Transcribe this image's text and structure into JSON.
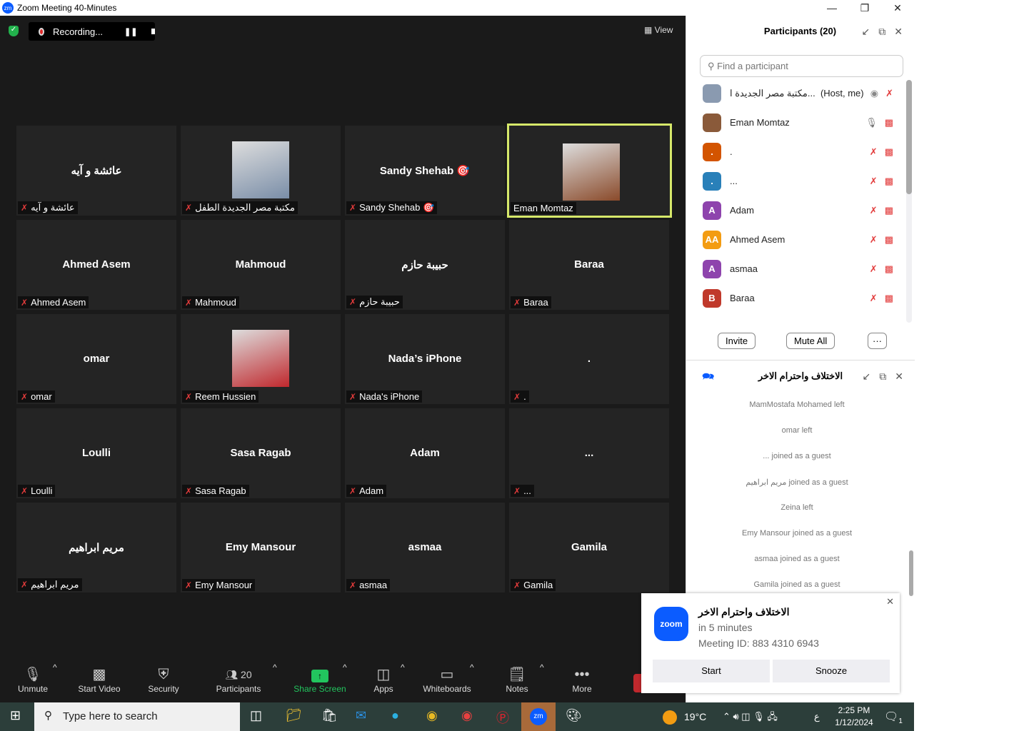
{
  "window": {
    "title": "Zoom Meeting 40-Minutes",
    "app_icon": "zm"
  },
  "recording": {
    "label": "Recording..."
  },
  "view_label": "View",
  "tiles": [
    {
      "big": "عائشة و آيه",
      "name": "عائشة و آيه"
    },
    {
      "big": "",
      "name": "مكتبة مصر الجديدة الطفل"
    },
    {
      "big": "Sandy  Shehab 🎯",
      "name": "Sandy Shehab 🎯"
    },
    {
      "big": "",
      "name": "Eman Momtaz"
    },
    {
      "big": "Ahmed Asem",
      "name": "Ahmed Asem"
    },
    {
      "big": "Mahmoud",
      "name": "Mahmoud"
    },
    {
      "big": "حبيبة حازم",
      "name": "حبيبة حازم"
    },
    {
      "big": "Baraa",
      "name": "Baraa"
    },
    {
      "big": "omar",
      "name": "omar"
    },
    {
      "big": "",
      "name": "Reem Hussien"
    },
    {
      "big": "Nada’s iPhone",
      "name": "Nada's iPhone"
    },
    {
      "big": ".",
      "name": "."
    },
    {
      "big": "Loulli",
      "name": "Loulli"
    },
    {
      "big": "Sasa Ragab",
      "name": "Sasa Ragab"
    },
    {
      "big": "Adam",
      "name": "Adam"
    },
    {
      "big": "...",
      "name": "..."
    },
    {
      "big": "مريم ابراهيم",
      "name": "مريم ابراهيم"
    },
    {
      "big": "Emy Mansour",
      "name": "Emy Mansour"
    },
    {
      "big": "asmaa",
      "name": "asmaa"
    },
    {
      "big": "Gamila",
      "name": "Gamila"
    }
  ],
  "toolbar": {
    "unmute": "Unmute",
    "start_video": "Start Video",
    "security": "Security",
    "participants": "Participants",
    "participants_count": "20",
    "share": "Share Screen",
    "apps": "Apps",
    "whiteboards": "Whiteboards",
    "notes": "Notes",
    "more": "More"
  },
  "participants": {
    "title": "Participants (20)",
    "search_placeholder": "Find a participant",
    "items": [
      {
        "name": "مكتبة مصر الجديدة ا...",
        "tag": "(Host, me)",
        "initials": "",
        "color": "#8a9ab0"
      },
      {
        "name": "Eman Momtaz",
        "initials": "",
        "color": "#8a5a3a"
      },
      {
        "name": ".",
        "initials": ".",
        "color": "#d35400"
      },
      {
        "name": "...",
        "initials": ".",
        "color": "#2980b9"
      },
      {
        "name": "Adam",
        "initials": "A",
        "color": "#8e44ad"
      },
      {
        "name": "Ahmed Asem",
        "initials": "AA",
        "color": "#f39c12"
      },
      {
        "name": "asmaa",
        "initials": "A",
        "color": "#8e44ad"
      },
      {
        "name": "Baraa",
        "initials": "B",
        "color": "#c0392b"
      }
    ],
    "invite": "Invite",
    "mute_all": "Mute All",
    "more": "···"
  },
  "chat": {
    "title": "الاختلاف واحترام الاخر",
    "messages": [
      "MamMostafa Mohamed left",
      "omar left",
      "... joined as a guest",
      "مريم ابراهيم joined as a guest",
      "Zeina left",
      "Emy Mansour joined as a guest",
      "asmaa joined as a guest",
      "Gamila joined as a guest"
    ]
  },
  "notification": {
    "logo": "zoom",
    "title": "الاختلاف واحترام الاخر",
    "time": "in 5 minutes",
    "meeting_id": "Meeting ID: 883 4310 6943",
    "start": "Start",
    "snooze": "Snooze"
  },
  "taskbar": {
    "search_placeholder": "Type here to search",
    "weather": "19°C",
    "lang": "ع",
    "time": "2:25 PM",
    "date": "1/12/2024",
    "notif_count": "1"
  }
}
